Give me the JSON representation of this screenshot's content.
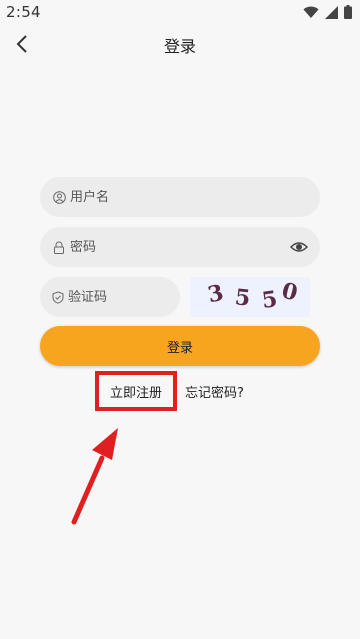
{
  "status_bar": {
    "time": "2:54",
    "icons": [
      "wifi-icon",
      "signal-icon",
      "battery-icon"
    ]
  },
  "header": {
    "title": "登录",
    "back_icon": "chevron-left-icon"
  },
  "form": {
    "username": {
      "placeholder": "用户名",
      "value": "",
      "icon": "user-icon"
    },
    "password": {
      "placeholder": "密码",
      "value": "",
      "icon": "lock-icon",
      "toggle_icon": "eye-icon"
    },
    "captcha_input": {
      "placeholder": "验证码",
      "value": "",
      "icon": "shield-icon"
    },
    "captcha_image": {
      "characters": [
        "3",
        "5",
        "5",
        "0"
      ]
    },
    "login_button": "登录"
  },
  "links": {
    "register": "立即注册",
    "forgot": "忘记密码?"
  },
  "colors": {
    "accent": "#f7a51e",
    "highlight": "#e02020",
    "field_background": "#ececec",
    "page_background": "#f7f7f7"
  }
}
